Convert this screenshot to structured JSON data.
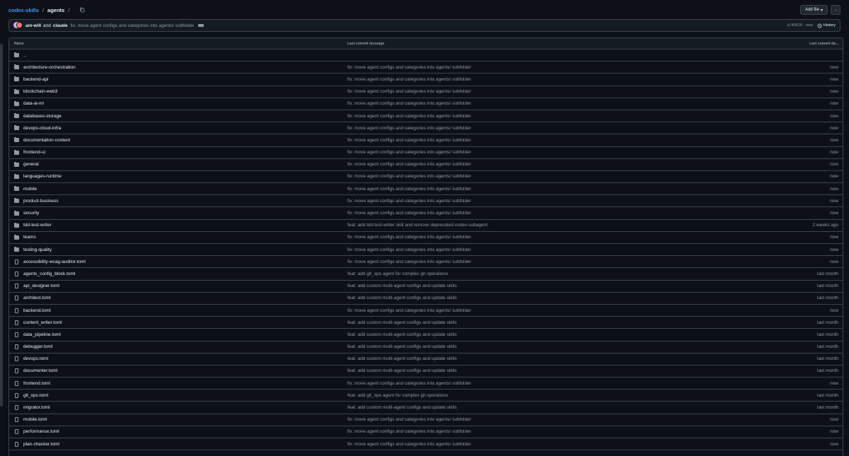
{
  "breadcrumb": {
    "repo": "codex-skills",
    "sep1": "/",
    "dir": "agents",
    "sep2": "/"
  },
  "toolbar": {
    "add_file_label": "Add file",
    "add_file_caret": "▾",
    "more_label": "···"
  },
  "commit": {
    "author1": "am-will",
    "and": "and",
    "author2": "claude",
    "message": "fix: move agent configs and categories into agents/ subfolder",
    "meta": "a740618 · now",
    "history_label": "History"
  },
  "table": {
    "headers": {
      "name": "Name",
      "message": "Last commit message",
      "date": "Last commit da..."
    },
    "rows": [
      {
        "icon": "folder-icon",
        "name": "..",
        "message": "",
        "date": ""
      },
      {
        "icon": "folder-icon",
        "name": "architecture-orchestration",
        "message": "fix: move agent configs and categories into agents/ subfolder",
        "date": "now"
      },
      {
        "icon": "folder-icon",
        "name": "backend-api",
        "message": "fix: move agent configs and categories into agents/ subfolder",
        "date": "now"
      },
      {
        "icon": "folder-icon",
        "name": "blockchain-web3",
        "message": "fix: move agent configs and categories into agents/ subfolder",
        "date": "now"
      },
      {
        "icon": "folder-icon",
        "name": "data-ai-ml",
        "message": "fix: move agent configs and categories into agents/ subfolder",
        "date": "now"
      },
      {
        "icon": "folder-icon",
        "name": "databases-storage",
        "message": "fix: move agent configs and categories into agents/ subfolder",
        "date": "now"
      },
      {
        "icon": "folder-icon",
        "name": "devops-cloud-infra",
        "message": "fix: move agent configs and categories into agents/ subfolder",
        "date": "now"
      },
      {
        "icon": "folder-icon",
        "name": "documentation-content",
        "message": "fix: move agent configs and categories into agents/ subfolder",
        "date": "now"
      },
      {
        "icon": "folder-icon",
        "name": "frontend-ui",
        "message": "fix: move agent configs and categories into agents/ subfolder",
        "date": "now"
      },
      {
        "icon": "folder-icon",
        "name": "general",
        "message": "fix: move agent configs and categories into agents/ subfolder",
        "date": "now"
      },
      {
        "icon": "folder-icon",
        "name": "languages-runtime",
        "message": "fix: move agent configs and categories into agents/ subfolder",
        "date": "now"
      },
      {
        "icon": "folder-icon",
        "name": "mobile",
        "message": "fix: move agent configs and categories into agents/ subfolder",
        "date": "now"
      },
      {
        "icon": "folder-icon",
        "name": "product-business",
        "message": "fix: move agent configs and categories into agents/ subfolder",
        "date": "now"
      },
      {
        "icon": "folder-icon",
        "name": "security",
        "message": "fix: move agent configs and categories into agents/ subfolder",
        "date": "now"
      },
      {
        "icon": "folder-icon",
        "name": "tdd-test-writer",
        "message": "feat: add tdd-test-writer skill and remove deprecated codex-subagent",
        "date": "2 weeks ago"
      },
      {
        "icon": "folder-icon",
        "name": "teams",
        "message": "fix: move agent configs and categories into agents/ subfolder",
        "date": "now"
      },
      {
        "icon": "folder-icon",
        "name": "testing-quality",
        "message": "fix: move agent configs and categories into agents/ subfolder",
        "date": "now"
      },
      {
        "icon": "file-icon",
        "name": "accessibility-wcag-auditor.toml",
        "message": "fix: move agent configs and categories into agents/ subfolder",
        "date": "now"
      },
      {
        "icon": "file-icon",
        "name": "agents_config_block.toml",
        "message": "feat: add git_ops agent for complex git operations",
        "date": "last month"
      },
      {
        "icon": "file-icon",
        "name": "api_designer.toml",
        "message": "feat: add custom multi-agent configs and update skills",
        "date": "last month"
      },
      {
        "icon": "file-icon",
        "name": "architect.toml",
        "message": "feat: add custom multi-agent configs and update skills",
        "date": "last month"
      },
      {
        "icon": "file-icon",
        "name": "backend.toml",
        "message": "fix: move agent configs and categories into agents/ subfolder",
        "date": "now"
      },
      {
        "icon": "file-icon",
        "name": "content_writer.toml",
        "message": "feat: add custom multi-agent configs and update skills",
        "date": "last month"
      },
      {
        "icon": "file-icon",
        "name": "data_pipeline.toml",
        "message": "feat: add custom multi-agent configs and update skills",
        "date": "last month"
      },
      {
        "icon": "file-icon",
        "name": "debugger.toml",
        "message": "feat: add custom multi-agent configs and update skills",
        "date": "last month"
      },
      {
        "icon": "file-icon",
        "name": "devops.toml",
        "message": "feat: add custom multi-agent configs and update skills",
        "date": "last month"
      },
      {
        "icon": "file-icon",
        "name": "documenter.toml",
        "message": "feat: add custom multi-agent configs and update skills",
        "date": "last month"
      },
      {
        "icon": "file-icon",
        "name": "frontend.toml",
        "message": "fix: move agent configs and categories into agents/ subfolder",
        "date": "now"
      },
      {
        "icon": "file-icon",
        "name": "git_ops.toml",
        "message": "feat: add git_ops agent for complex git operations",
        "date": "last month"
      },
      {
        "icon": "file-icon",
        "name": "migrator.toml",
        "message": "feat: add custom multi-agent configs and update skills",
        "date": "last month"
      },
      {
        "icon": "file-icon",
        "name": "mobile.toml",
        "message": "fix: move agent configs and categories into agents/ subfolder",
        "date": "now"
      },
      {
        "icon": "file-icon",
        "name": "performance.toml",
        "message": "fix: move agent configs and categories into agents/ subfolder",
        "date": "now"
      },
      {
        "icon": "file-icon",
        "name": "plan-checker.toml",
        "message": "fix: move agent configs and categories into agents/ subfolder",
        "date": "now"
      }
    ]
  },
  "colors": {
    "background": "#0d1117",
    "link": "#4493f8",
    "border": "#3d444d",
    "muted": "#9198a1"
  }
}
